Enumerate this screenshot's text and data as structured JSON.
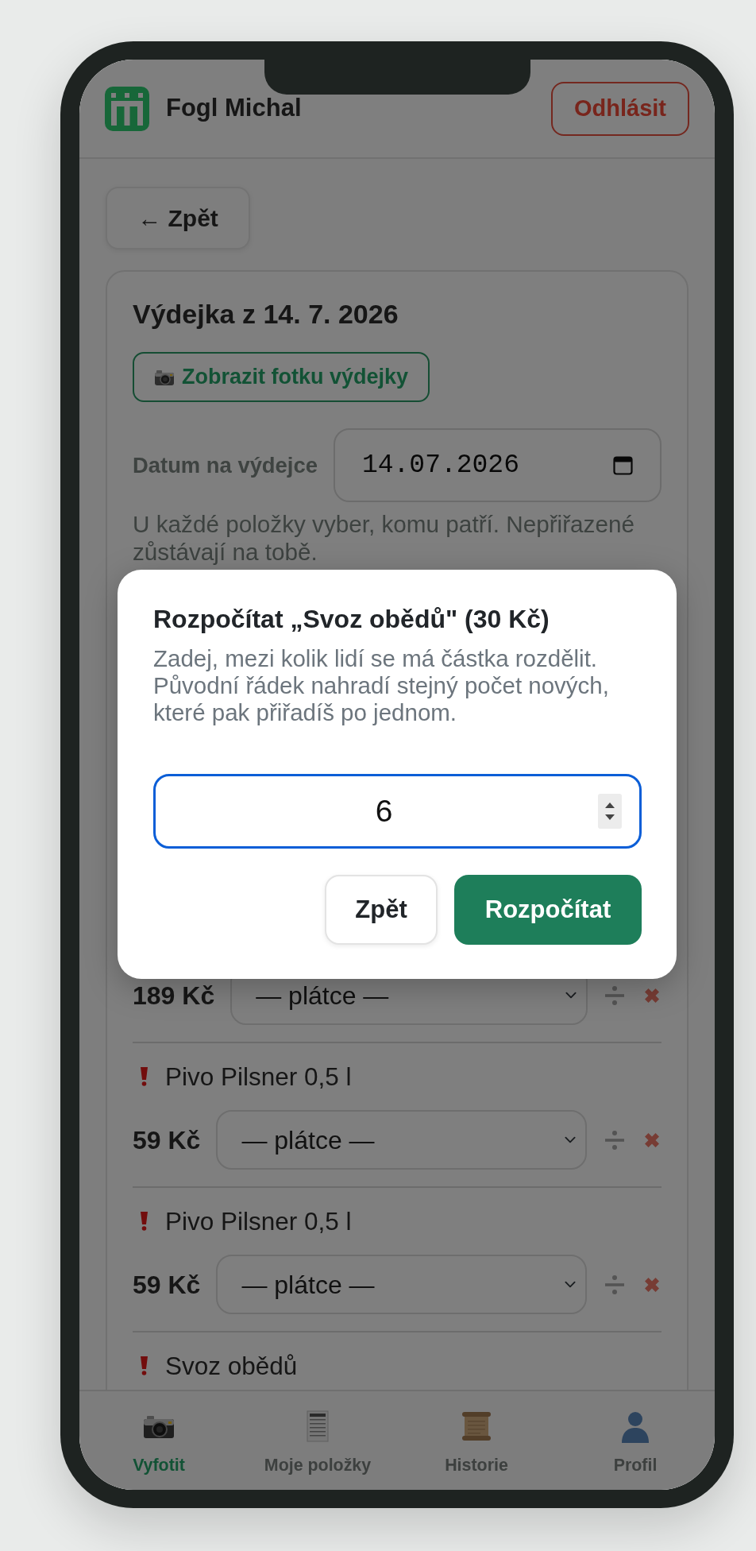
{
  "header": {
    "user_name": "Fogl Michal",
    "logout_button": "Odhlásit"
  },
  "back_button": "← Zpět",
  "receipt": {
    "title": "Výdejka z 14. 7. 2026",
    "photo_button": "Zobrazit fotku výdejky",
    "date_label": "Datum na výdejce",
    "date_value": "14.07.2026",
    "hint": "U každé položky vyber, komu patří. Nepřiřazené zůstávají na tobě."
  },
  "items": [
    {
      "price": "189 Kč",
      "payer": "— plátce —"
    },
    {
      "name": "Pivo Pilsner 0,5 l",
      "unassigned": true,
      "price": "59 Kč",
      "payer": "— plátce —"
    },
    {
      "name": "Pivo Pilsner 0,5 l",
      "unassigned": true,
      "price": "59 Kč",
      "payer": "— plátce —"
    },
    {
      "name": "Svoz obědů",
      "unassigned": true
    }
  ],
  "bottom_nav": [
    {
      "label": "Vyfotit",
      "selected": true
    },
    {
      "label": "Moje položky",
      "selected": false
    },
    {
      "label": "Historie",
      "selected": false
    },
    {
      "label": "Profil",
      "selected": false
    }
  ],
  "split_dialog": {
    "title": "Rozpočítat „Svoz obědů\" (30 Kč)",
    "text": "Zadej, mezi kolik lidí se má částka rozdělit. Původní řádek nahradí stejný počet nových, které pak přiřadíš po jednom.",
    "count_value": "6",
    "cancel_button": "Zpět",
    "confirm_button": "Rozpočítat"
  }
}
